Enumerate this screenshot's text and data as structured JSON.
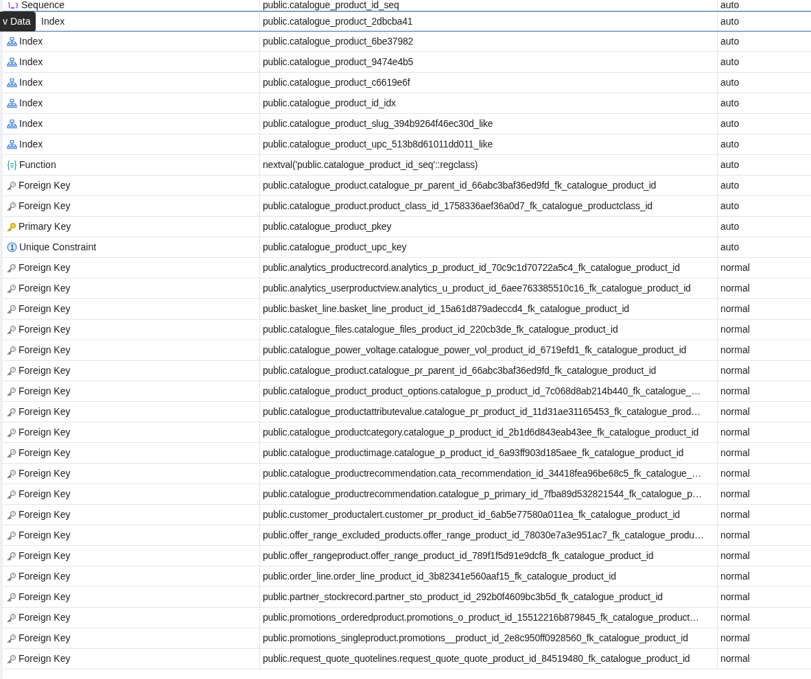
{
  "tooltip": "v Data",
  "rows": [
    {
      "kind": "sequence",
      "type": "Sequence",
      "name": "public.catalogue_product_id_seq",
      "mode": "auto",
      "selected": false
    },
    {
      "type": "Index",
      "name": "public.catalogue_product_2dbcba41",
      "mode": "auto",
      "selected": true
    },
    {
      "kind": "index",
      "type": "Index",
      "name": "public.catalogue_product_6be37982",
      "mode": "auto",
      "selected": false
    },
    {
      "kind": "index",
      "type": "Index",
      "name": "public.catalogue_product_9474e4b5",
      "mode": "auto",
      "selected": false
    },
    {
      "kind": "index",
      "type": "Index",
      "name": "public.catalogue_product_c6619e6f",
      "mode": "auto",
      "selected": false
    },
    {
      "kind": "index",
      "type": "Index",
      "name": "public.catalogue_product_id_idx",
      "mode": "auto",
      "selected": false
    },
    {
      "kind": "index",
      "type": "Index",
      "name": "public.catalogue_product_slug_394b9264f46ec30d_like",
      "mode": "auto",
      "selected": false
    },
    {
      "kind": "index",
      "type": "Index",
      "name": "public.catalogue_product_upc_513b8d61011dd011_like",
      "mode": "auto",
      "selected": false
    },
    {
      "kind": "function",
      "type": "Function",
      "name": "nextval('public.catalogue_product_id_seq'::regclass)",
      "mode": "auto",
      "selected": false
    },
    {
      "kind": "foreign_key",
      "type": "Foreign Key",
      "name": "public.catalogue_product.catalogue_pr_parent_id_66abc3baf36ed9fd_fk_catalogue_product_id",
      "mode": "auto",
      "selected": false
    },
    {
      "kind": "foreign_key",
      "type": "Foreign Key",
      "name": "public.catalogue_product.product_class_id_1758336aef36a0d7_fk_catalogue_productclass_id",
      "mode": "auto",
      "selected": false
    },
    {
      "kind": "primary_key",
      "type": "Primary Key",
      "name": "public.catalogue_product_pkey",
      "mode": "auto",
      "selected": false
    },
    {
      "kind": "unique",
      "type": "Unique Constraint",
      "name": "public.catalogue_product_upc_key",
      "mode": "auto",
      "selected": false
    },
    {
      "kind": "foreign_key",
      "type": "Foreign Key",
      "name": "public.analytics_productrecord.analytics_p_product_id_70c9c1d70722a5c4_fk_catalogue_product_id",
      "mode": "normal",
      "selected": false
    },
    {
      "kind": "foreign_key",
      "type": "Foreign Key",
      "name": "public.analytics_userproductview.analytics_u_product_id_6aee763385510c16_fk_catalogue_product_id",
      "mode": "normal",
      "selected": false
    },
    {
      "kind": "foreign_key",
      "type": "Foreign Key",
      "name": "public.basket_line.basket_line_product_id_15a61d879adeccd4_fk_catalogue_product_id",
      "mode": "normal",
      "selected": false
    },
    {
      "kind": "foreign_key",
      "type": "Foreign Key",
      "name": "public.catalogue_files.catalogue_files_product_id_220cb3de_fk_catalogue_product_id",
      "mode": "normal",
      "selected": false
    },
    {
      "kind": "foreign_key",
      "type": "Foreign Key",
      "name": "public.catalogue_power_voltage.catalogue_power_vol_product_id_6719efd1_fk_catalogue_product_id",
      "mode": "normal",
      "selected": false
    },
    {
      "kind": "foreign_key",
      "type": "Foreign Key",
      "name": "public.catalogue_product.catalogue_pr_parent_id_66abc3baf36ed9fd_fk_catalogue_product_id",
      "mode": "normal",
      "selected": false
    },
    {
      "kind": "foreign_key",
      "type": "Foreign Key",
      "name": "public.catalogue_product_product_options.catalogue_p_product_id_7c068d8ab214b440_fk_catalogue_…",
      "mode": "normal",
      "selected": false
    },
    {
      "kind": "foreign_key",
      "type": "Foreign Key",
      "name": "public.catalogue_productattributevalue.catalogue_pr_product_id_11d31ae31165453_fk_catalogue_prod…",
      "mode": "normal",
      "selected": false
    },
    {
      "kind": "foreign_key",
      "type": "Foreign Key",
      "name": "public.catalogue_productcategory.catalogue_p_product_id_2b1d6d843eab43ee_fk_catalogue_product_id",
      "mode": "normal",
      "selected": false
    },
    {
      "kind": "foreign_key",
      "type": "Foreign Key",
      "name": "public.catalogue_productimage.catalogue_p_product_id_6a93ff903d185aee_fk_catalogue_product_id",
      "mode": "normal",
      "selected": false
    },
    {
      "kind": "foreign_key",
      "type": "Foreign Key",
      "name": "public.catalogue_productrecommendation.cata_recommendation_id_34418fea96be68c5_fk_catalogue_…",
      "mode": "normal",
      "selected": false
    },
    {
      "kind": "foreign_key",
      "type": "Foreign Key",
      "name": "public.catalogue_productrecommendation.catalogue_p_primary_id_7fba89d532821544_fk_catalogue_p…",
      "mode": "normal",
      "selected": false
    },
    {
      "kind": "foreign_key",
      "type": "Foreign Key",
      "name": "public.customer_productalert.customer_pr_product_id_6ab5e77580a011ea_fk_catalogue_product_id",
      "mode": "normal",
      "selected": false
    },
    {
      "kind": "foreign_key",
      "type": "Foreign Key",
      "name": "public.offer_range_excluded_products.offer_range_product_id_78030e7a3e951ac7_fk_catalogue_produ…",
      "mode": "normal",
      "selected": false
    },
    {
      "kind": "foreign_key",
      "type": "Foreign Key",
      "name": "public.offer_rangeproduct.offer_range_product_id_789f1f5d91e9dcf8_fk_catalogue_product_id",
      "mode": "normal",
      "selected": false
    },
    {
      "kind": "foreign_key",
      "type": "Foreign Key",
      "name": "public.order_line.order_line_product_id_3b82341e560aaf15_fk_catalogue_product_id",
      "mode": "normal",
      "selected": false
    },
    {
      "kind": "foreign_key",
      "type": "Foreign Key",
      "name": "public.partner_stockrecord.partner_sto_product_id_292b0f4609bc3b5d_fk_catalogue_product_id",
      "mode": "normal",
      "selected": false
    },
    {
      "kind": "foreign_key",
      "type": "Foreign Key",
      "name": "public.promotions_orderedproduct.promotions_o_product_id_15512216b879845_fk_catalogue_product…",
      "mode": "normal",
      "selected": false
    },
    {
      "kind": "foreign_key",
      "type": "Foreign Key",
      "name": "public.promotions_singleproduct.promotions__product_id_2e8c950ff0928560_fk_catalogue_product_id",
      "mode": "normal",
      "selected": false
    },
    {
      "kind": "foreign_key",
      "type": "Foreign Key",
      "name": "public.request_quote_quotelines.request_quote_quote_product_id_84519480_fk_catalogue_product_id",
      "mode": "normal",
      "selected": false
    }
  ]
}
